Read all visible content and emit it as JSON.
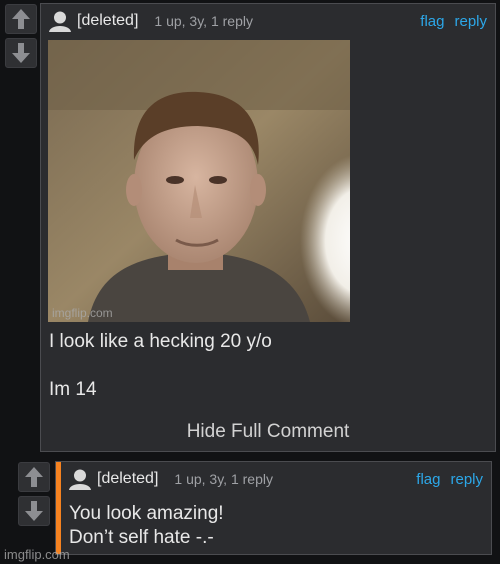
{
  "comment1": {
    "author": "[deleted]",
    "meta": "1 up, 3y, 1 reply",
    "flag_label": "flag",
    "reply_label": "reply",
    "image_watermark": "imgflip.com",
    "text_line1": "I look like a hecking 20 y/o",
    "text_line2": "Im 14",
    "hide_full_label": "Hide Full Comment"
  },
  "comment2": {
    "author": "[deleted]",
    "meta": "1 up, 3y, 1 reply",
    "flag_label": "flag",
    "reply_label": "reply",
    "text_line1": "You look amazing!",
    "text_line2": "Don’t self hate -.-"
  },
  "watermark": "imgflip.com",
  "colors": {
    "link": "#2ca7e8",
    "accent": "#f58220",
    "panel": "#2b2c2f"
  },
  "icons": [
    "arrow-up-icon",
    "arrow-down-icon",
    "user-avatar-icon"
  ]
}
